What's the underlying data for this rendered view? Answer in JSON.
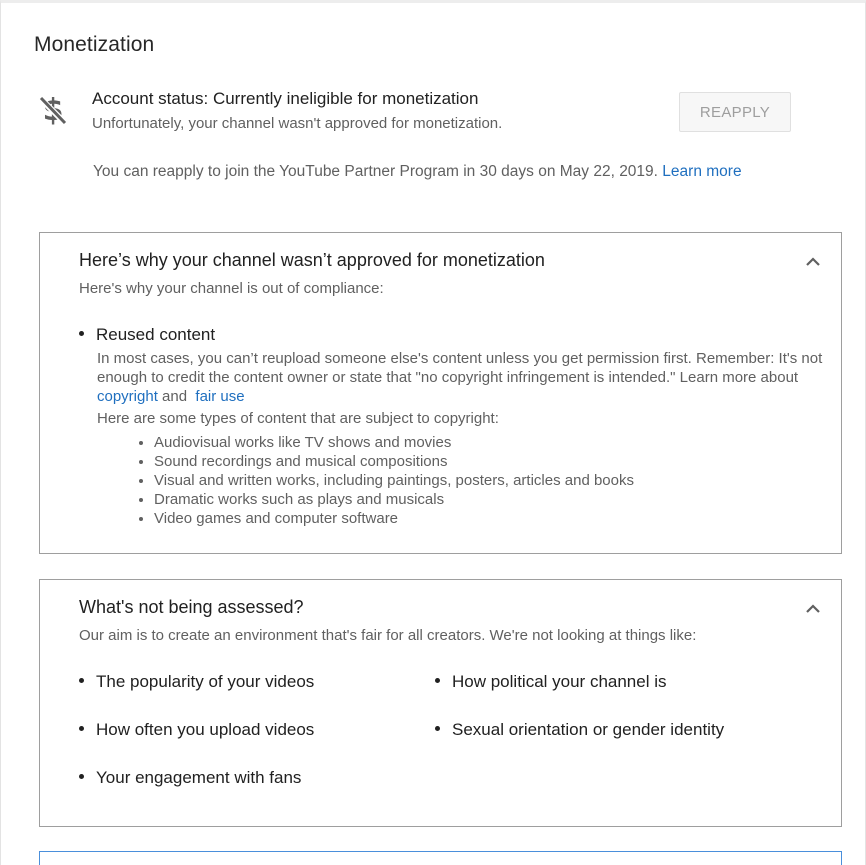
{
  "section": {
    "title": "Monetization"
  },
  "status": {
    "icon": "no-dollar-icon",
    "title": "Account status: Currently ineligible for monetization",
    "subtitle": "Unfortunately, your channel wasn't approved for monetization.",
    "reapply_label": "REAPPLY",
    "reapply_note": "You can reapply to join the YouTube Partner Program in 30 days on May 22, 2019.",
    "learn_more": "Learn more"
  },
  "why_card": {
    "title": "Here’s why your channel wasn’t approved for monetization",
    "subtitle": "Here's why your channel is out of compliance:",
    "reason": "Reused content",
    "desc_part1": "In most cases, you can’t reupload someone else's content unless you get permission first. Remember: It's not enough to credit the content owner or state that \"no copyright infringement is intended.\" Learn more about",
    "copyright_link": "copyright",
    "and": "and",
    "fair_use_link": "fair use",
    "types_intro": "Here are some types of content that are subject to copyright:",
    "types": [
      "Audiovisual works like TV shows and movies",
      "Sound recordings and musical compositions",
      "Visual and written works, including paintings, posters, articles and books",
      "Dramatic works such as plays and musicals",
      "Video games and computer software"
    ]
  },
  "not_assessed_card": {
    "title": "What's not being assessed?",
    "subtitle": "Our aim is to create an environment that's fair for all creators. We're not looking at things like:",
    "items": [
      "The popularity of your videos",
      "How political your channel is",
      "How often you upload videos",
      "Sexual orientation or gender identity",
      "Your engagement with fans"
    ]
  },
  "colors": {
    "link": "#1f6fbf",
    "card_border": "#9e9e9e",
    "focused_border": "#4a8fdb"
  }
}
